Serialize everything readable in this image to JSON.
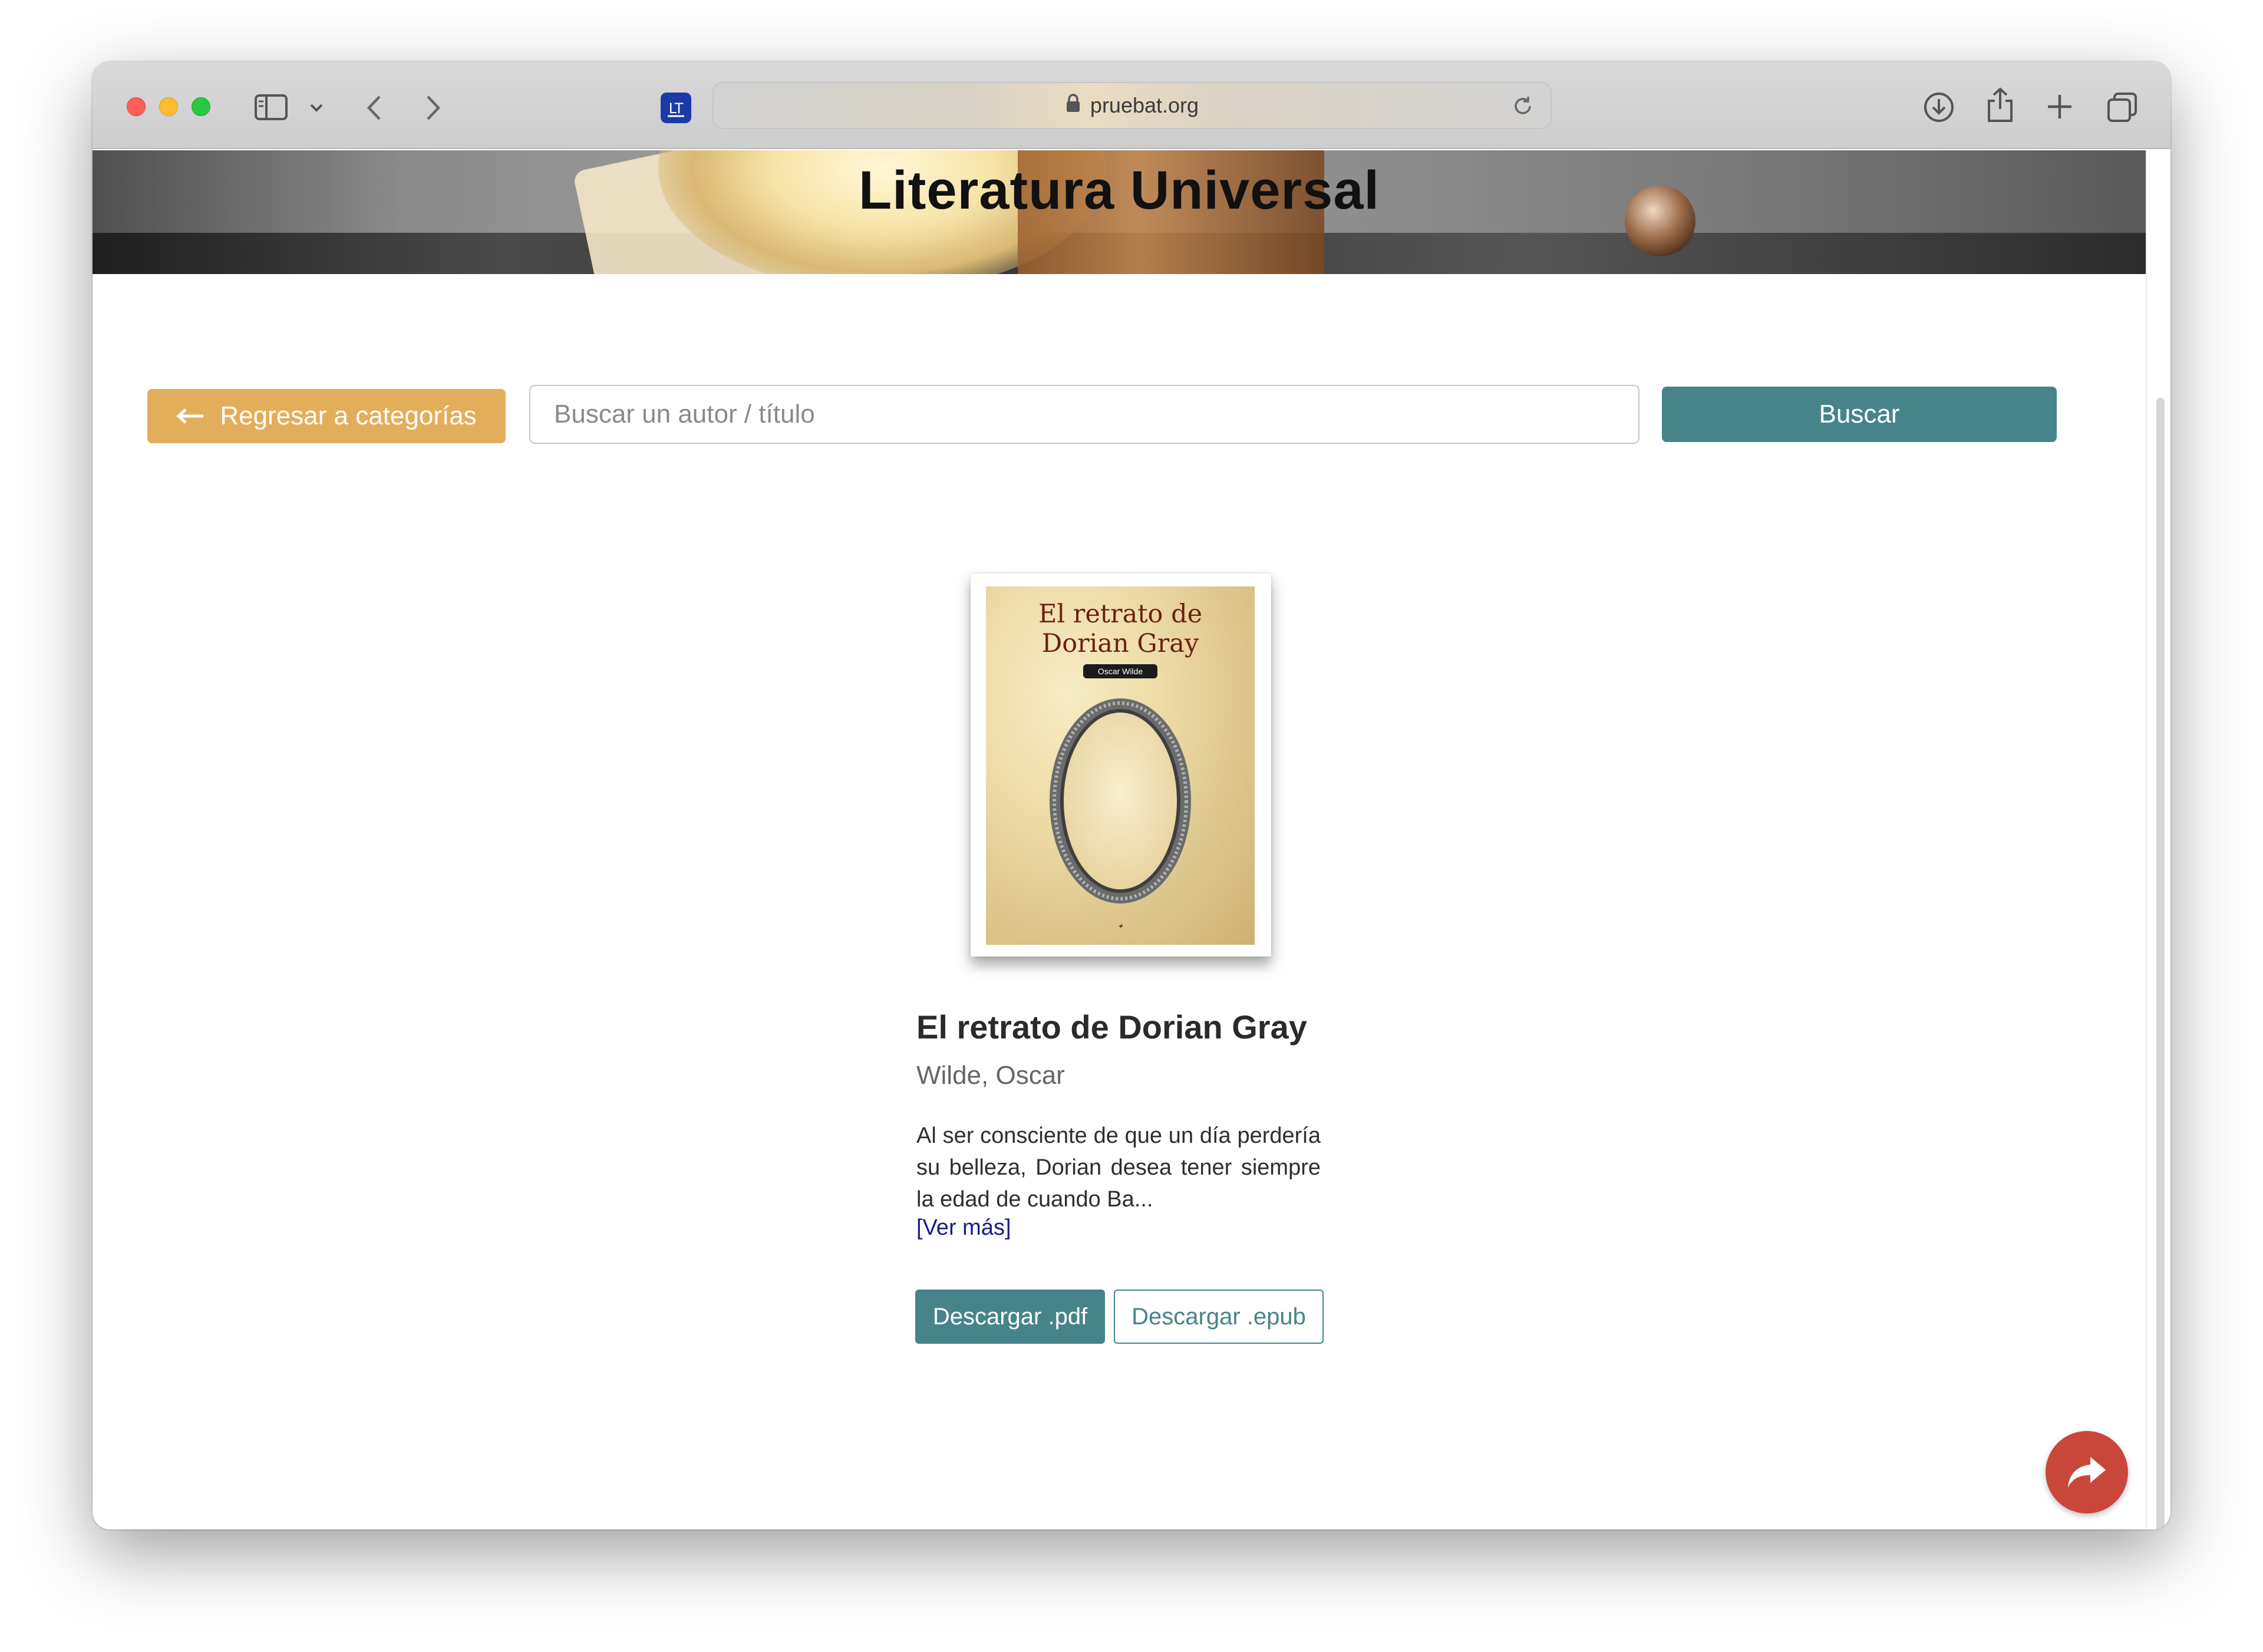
{
  "browser": {
    "url": "pruebat.org",
    "icons": [
      "sidebar-icon",
      "chevron-down-icon",
      "back-icon",
      "forward-icon",
      "extension-icon",
      "lock-icon",
      "reload-icon",
      "download-icon",
      "share-icon",
      "new-tab-icon",
      "tabs-overview-icon"
    ]
  },
  "banner": {
    "title": "Literatura Universal"
  },
  "search": {
    "back_label": "Regresar a categorías",
    "placeholder": "Buscar un autor / título",
    "button_label": "Buscar"
  },
  "book": {
    "cover_title_line1": "El retrato de",
    "cover_title_line2": "Dorian Gray",
    "cover_author": "Oscar Wilde",
    "title": "El retrato de Dorian Gray",
    "author": "Wilde, Oscar",
    "description": "Al ser consciente de que un día perdería su belleza, Dorian desea tener siempre la edad de cuando Ba...",
    "more_link": "[Ver más]",
    "download_pdf": "Descargar .pdf",
    "download_epub": "Descargar .epub"
  },
  "colors": {
    "accent_teal": "#46848a",
    "accent_orange": "#e3ae5b",
    "share_red": "#c9473a",
    "link_blue": "#1a1a8c"
  }
}
